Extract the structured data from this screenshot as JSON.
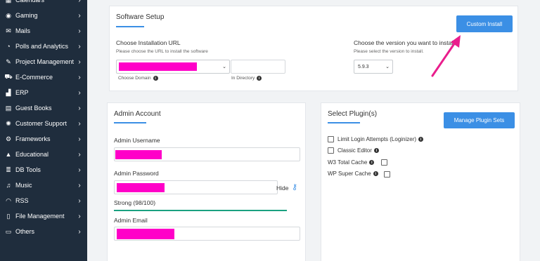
{
  "sidebar": {
    "items": [
      {
        "label": "Calendars",
        "icon": "calendar-icon",
        "glyph": "▦"
      },
      {
        "label": "Gaming",
        "icon": "gamepad-icon",
        "glyph": "◉"
      },
      {
        "label": "Mails",
        "icon": "mail-icon",
        "glyph": "✉"
      },
      {
        "label": "Polls and Analytics",
        "icon": "pie-chart-icon",
        "glyph": "◔"
      },
      {
        "label": "Project Management",
        "icon": "edit-icon",
        "glyph": "✎"
      },
      {
        "label": "E-Commerce",
        "icon": "cart-icon",
        "glyph": "⛟"
      },
      {
        "label": "ERP",
        "icon": "chart-icon",
        "glyph": "▟"
      },
      {
        "label": "Guest Books",
        "icon": "book-icon",
        "glyph": "▤"
      },
      {
        "label": "Customer Support",
        "icon": "support-icon",
        "glyph": "✺"
      },
      {
        "label": "Frameworks",
        "icon": "cogs-icon",
        "glyph": "⚙"
      },
      {
        "label": "Educational",
        "icon": "graduation-icon",
        "glyph": "▲"
      },
      {
        "label": "DB Tools",
        "icon": "database-icon",
        "glyph": "≣"
      },
      {
        "label": "Music",
        "icon": "music-icon",
        "glyph": "♫"
      },
      {
        "label": "RSS",
        "icon": "rss-icon",
        "glyph": "◠"
      },
      {
        "label": "File Management",
        "icon": "file-icon",
        "glyph": "▯"
      },
      {
        "label": "Others",
        "icon": "folder-icon",
        "glyph": "▭"
      }
    ],
    "chevron": "›"
  },
  "software_setup": {
    "title": "Software Setup",
    "custom_install_label": "Custom Install",
    "url_label": "Choose Installation URL",
    "url_sublabel": "Please choose the URL to install the software",
    "choose_domain_label": "Choose Domain",
    "in_directory_label": "In Directory",
    "version_label": "Choose the version you want to install",
    "version_sublabel": "Please select the version to install.",
    "version_value": "5.9.3"
  },
  "admin_account": {
    "title": "Admin Account",
    "username_label": "Admin Username",
    "password_label": "Admin Password",
    "hide_label": "Hide",
    "strength_text": "Strong (98/100)",
    "strength_fraction": 0.98,
    "email_label": "Admin Email"
  },
  "plugins": {
    "title": "Select Plugin(s)",
    "manage_label": "Manage Plugin Sets",
    "items": [
      {
        "label": "Limit Login Attempts (Loginizer)"
      },
      {
        "label": "Classic Editor"
      },
      {
        "label": "W3 Total Cache"
      },
      {
        "label": "WP Super Cache"
      }
    ]
  },
  "colors": {
    "accent": "#3b8fe5",
    "sidebar_bg": "#1f2d3d",
    "redaction": "#ff00c8",
    "annotation_arrow": "#e91e8c",
    "strength": "#1aa180"
  }
}
